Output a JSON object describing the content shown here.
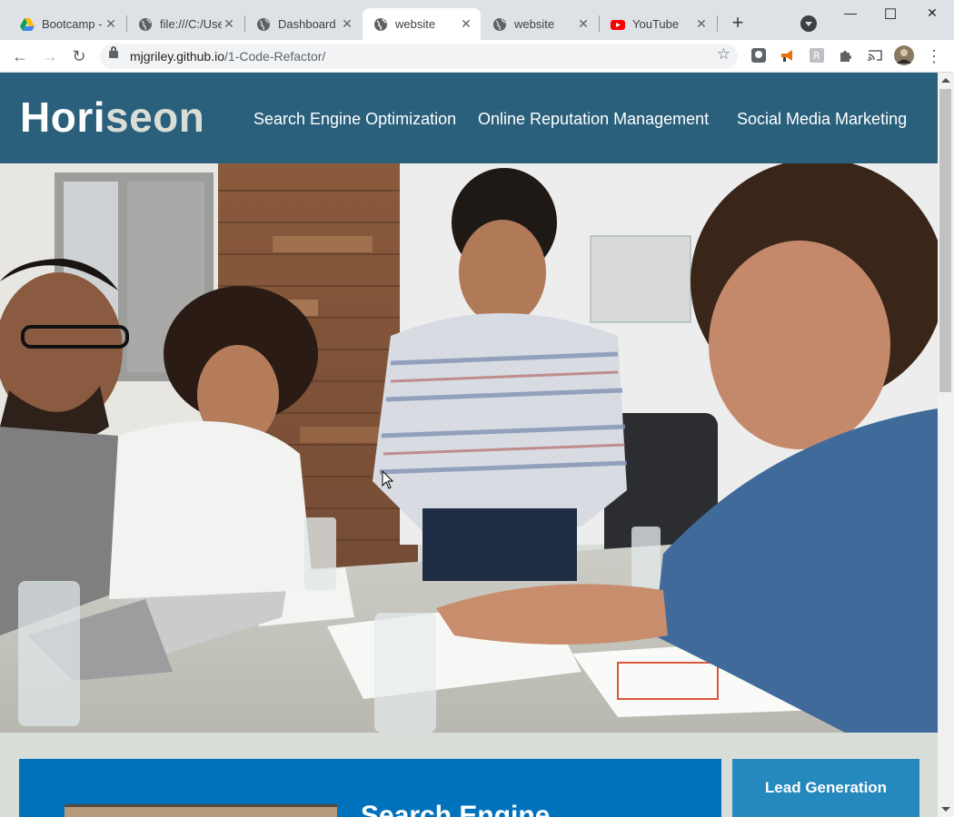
{
  "browser": {
    "tabs": [
      {
        "title": "Bootcamp -",
        "icon": "google-drive-icon",
        "active": false
      },
      {
        "title": "file:///C:/Use",
        "icon": "globe-icon",
        "active": false
      },
      {
        "title": "Dashboard |",
        "icon": "globe-icon",
        "active": false
      },
      {
        "title": "website",
        "icon": "globe-icon",
        "active": true
      },
      {
        "title": "website",
        "icon": "globe-icon",
        "active": false
      },
      {
        "title": "YouTube",
        "icon": "youtube-icon",
        "active": false
      }
    ],
    "new_tab_label": "+",
    "window_controls": {
      "minimize": "—",
      "maximize": "☐",
      "close": "✕"
    },
    "nav": {
      "back": "←",
      "forward": "→",
      "reload": "↻"
    },
    "url_host": "mjgriley.github.io",
    "url_path": "/1-Code-Refactor/",
    "bookmark_star": "☆",
    "menu_label": "⋮"
  },
  "site": {
    "logo_hori": "Hori",
    "logo_seon": "seon",
    "nav": [
      "Search Engine Optimization",
      "Online Reputation Management",
      "Social Media Marketing"
    ],
    "hero_alt": "",
    "content_heading": "Search Engine",
    "sidebar_title": "Lead Generation"
  },
  "colors": {
    "header_bg": "#2a607c",
    "content_bg": "#0072bb",
    "sidebar_bg": "#2589bd",
    "page_bg": "#d9ddd8"
  }
}
